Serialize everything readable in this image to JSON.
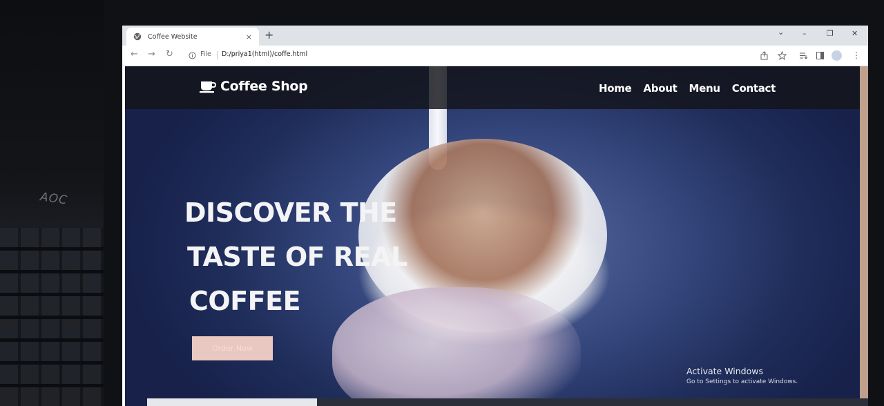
{
  "browser": {
    "tab_title": "Coffee Website",
    "tab_close": "×",
    "new_tab": "+",
    "file_label": "File",
    "url": "D:/priya1(html)/coffe.html",
    "window_controls": {
      "minimize": "–",
      "restore": "❐",
      "close": "✕"
    },
    "tab_search": "⌄"
  },
  "site": {
    "logo_text": "Coffee Shop",
    "nav": [
      {
        "label": "Home"
      },
      {
        "label": "About"
      },
      {
        "label": "Menu"
      },
      {
        "label": "Contact"
      }
    ],
    "hero_lines": [
      "DISCOVER THE",
      "TASTE OF REAL",
      "COFFEE"
    ],
    "cta_label": "Order Now"
  },
  "os": {
    "activate_title": "Activate Windows",
    "activate_sub": "Go to Settings to activate Windows."
  },
  "monitor_brand": "AOC",
  "colors": {
    "navbar": "#14141a",
    "hero_blue": "#34467c",
    "cta": "#e9c8c2",
    "text_light": "#ffffff"
  }
}
